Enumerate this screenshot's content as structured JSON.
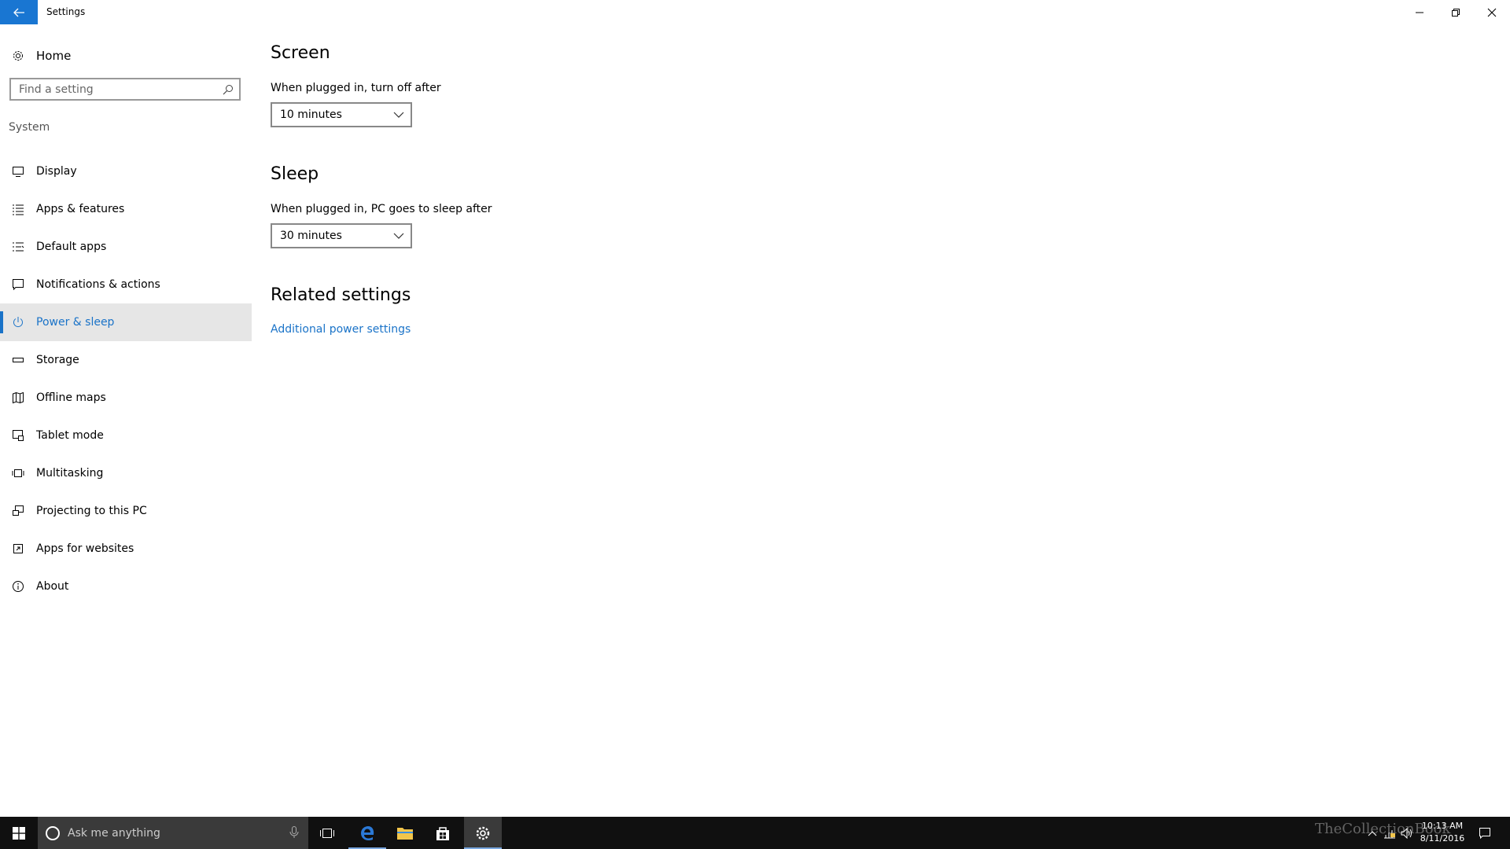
{
  "window": {
    "title": "Settings",
    "controls": [
      "minimize",
      "maximize",
      "close"
    ]
  },
  "sidebar": {
    "home_label": "Home",
    "search_placeholder": "Find a setting",
    "group_label": "System",
    "items": [
      {
        "label": "Display",
        "icon": "monitor-icon"
      },
      {
        "label": "Apps & features",
        "icon": "list-icon"
      },
      {
        "label": "Default apps",
        "icon": "default-apps-icon"
      },
      {
        "label": "Notifications & actions",
        "icon": "notification-icon"
      },
      {
        "label": "Power & sleep",
        "icon": "power-icon",
        "active": true
      },
      {
        "label": "Storage",
        "icon": "storage-icon"
      },
      {
        "label": "Offline maps",
        "icon": "map-icon"
      },
      {
        "label": "Tablet mode",
        "icon": "tablet-icon"
      },
      {
        "label": "Multitasking",
        "icon": "multitasking-icon"
      },
      {
        "label": "Projecting to this PC",
        "icon": "projecting-icon"
      },
      {
        "label": "Apps for websites",
        "icon": "website-apps-icon"
      },
      {
        "label": "About",
        "icon": "info-icon"
      }
    ]
  },
  "main": {
    "screen": {
      "heading": "Screen",
      "label": "When plugged in, turn off after",
      "value": "10 minutes"
    },
    "sleep": {
      "heading": "Sleep",
      "label": "When plugged in, PC goes to sleep after",
      "value": "30 minutes"
    },
    "related": {
      "heading": "Related settings",
      "link": "Additional power settings"
    }
  },
  "taskbar": {
    "search_text": "Ask me anything",
    "time": "10:13 AM",
    "date": "8/11/2016",
    "watermark": "TheCollectionBook"
  },
  "colors": {
    "accent": "#1a73c8",
    "back_button": "#1976d2",
    "taskbar": "#101010",
    "active_item_bg": "#e6e6e6"
  }
}
